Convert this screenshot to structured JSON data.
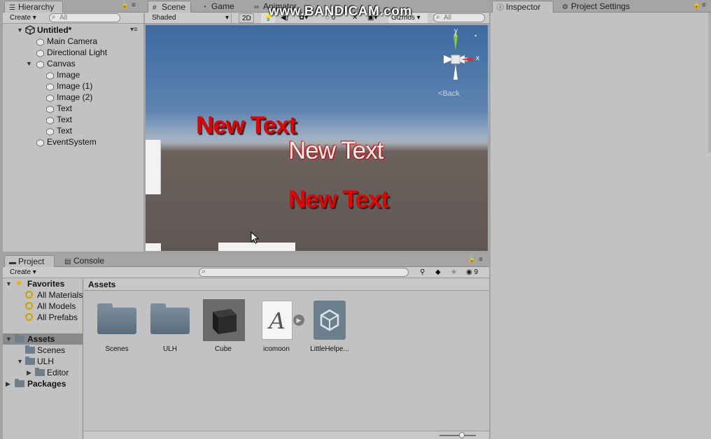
{
  "watermark": "www.BANDICAM.com",
  "hierarchy": {
    "tab_label": "Hierarchy",
    "create_label": "Create ▾",
    "search_placeholder": "All",
    "scene_name": "Untitled*",
    "items": [
      {
        "label": "Main Camera"
      },
      {
        "label": "Directional Light"
      },
      {
        "label": "Canvas"
      },
      {
        "label": "Image"
      },
      {
        "label": "Image (1)"
      },
      {
        "label": "Image (2)"
      },
      {
        "label": "Text"
      },
      {
        "label": "Text"
      },
      {
        "label": "Text"
      },
      {
        "label": "EventSystem"
      }
    ]
  },
  "scene_tabs": {
    "scene": "Scene",
    "game": "Game",
    "animator": "Animator"
  },
  "scene_toolbar": {
    "shading": "Shaded",
    "mode_2d": "2D",
    "fx_count": "0",
    "gizmos": "Gizmos ▾",
    "search_placeholder": "All"
  },
  "scene_view": {
    "texts": [
      "New Text",
      "New Text",
      "New Text"
    ],
    "gizmo_x_label": "x",
    "gizmo_y_label": "y",
    "back_label": "Back"
  },
  "inspector_tabs": {
    "inspector": "Inspector",
    "project_settings": "Project Settings"
  },
  "project": {
    "tab_project": "Project",
    "tab_console": "Console",
    "create_label": "Create ▾",
    "hidden_count": "9",
    "favorites": {
      "title": "Favorites",
      "items": [
        "All Materials",
        "All Models",
        "All Prefabs"
      ]
    },
    "tree": {
      "assets": "Assets",
      "scenes": "Scenes",
      "ulh": "ULH",
      "editor": "Editor",
      "packages": "Packages"
    },
    "breadcrumb": "Assets",
    "assets": [
      {
        "name": "Scenes",
        "icon": "folder-icon"
      },
      {
        "name": "ULH",
        "icon": "folder-icon"
      },
      {
        "name": "Cube",
        "icon": "cube-preview"
      },
      {
        "name": "icomoon",
        "icon": "font-icon"
      },
      {
        "name": "LittleHelpe...",
        "icon": "unity-logo-icon"
      }
    ]
  },
  "colors": {
    "text_red": "#e70000",
    "sky_top": "#3c6aa0",
    "ground": "#5e5753",
    "panel_bg": "#c2c2c2"
  }
}
